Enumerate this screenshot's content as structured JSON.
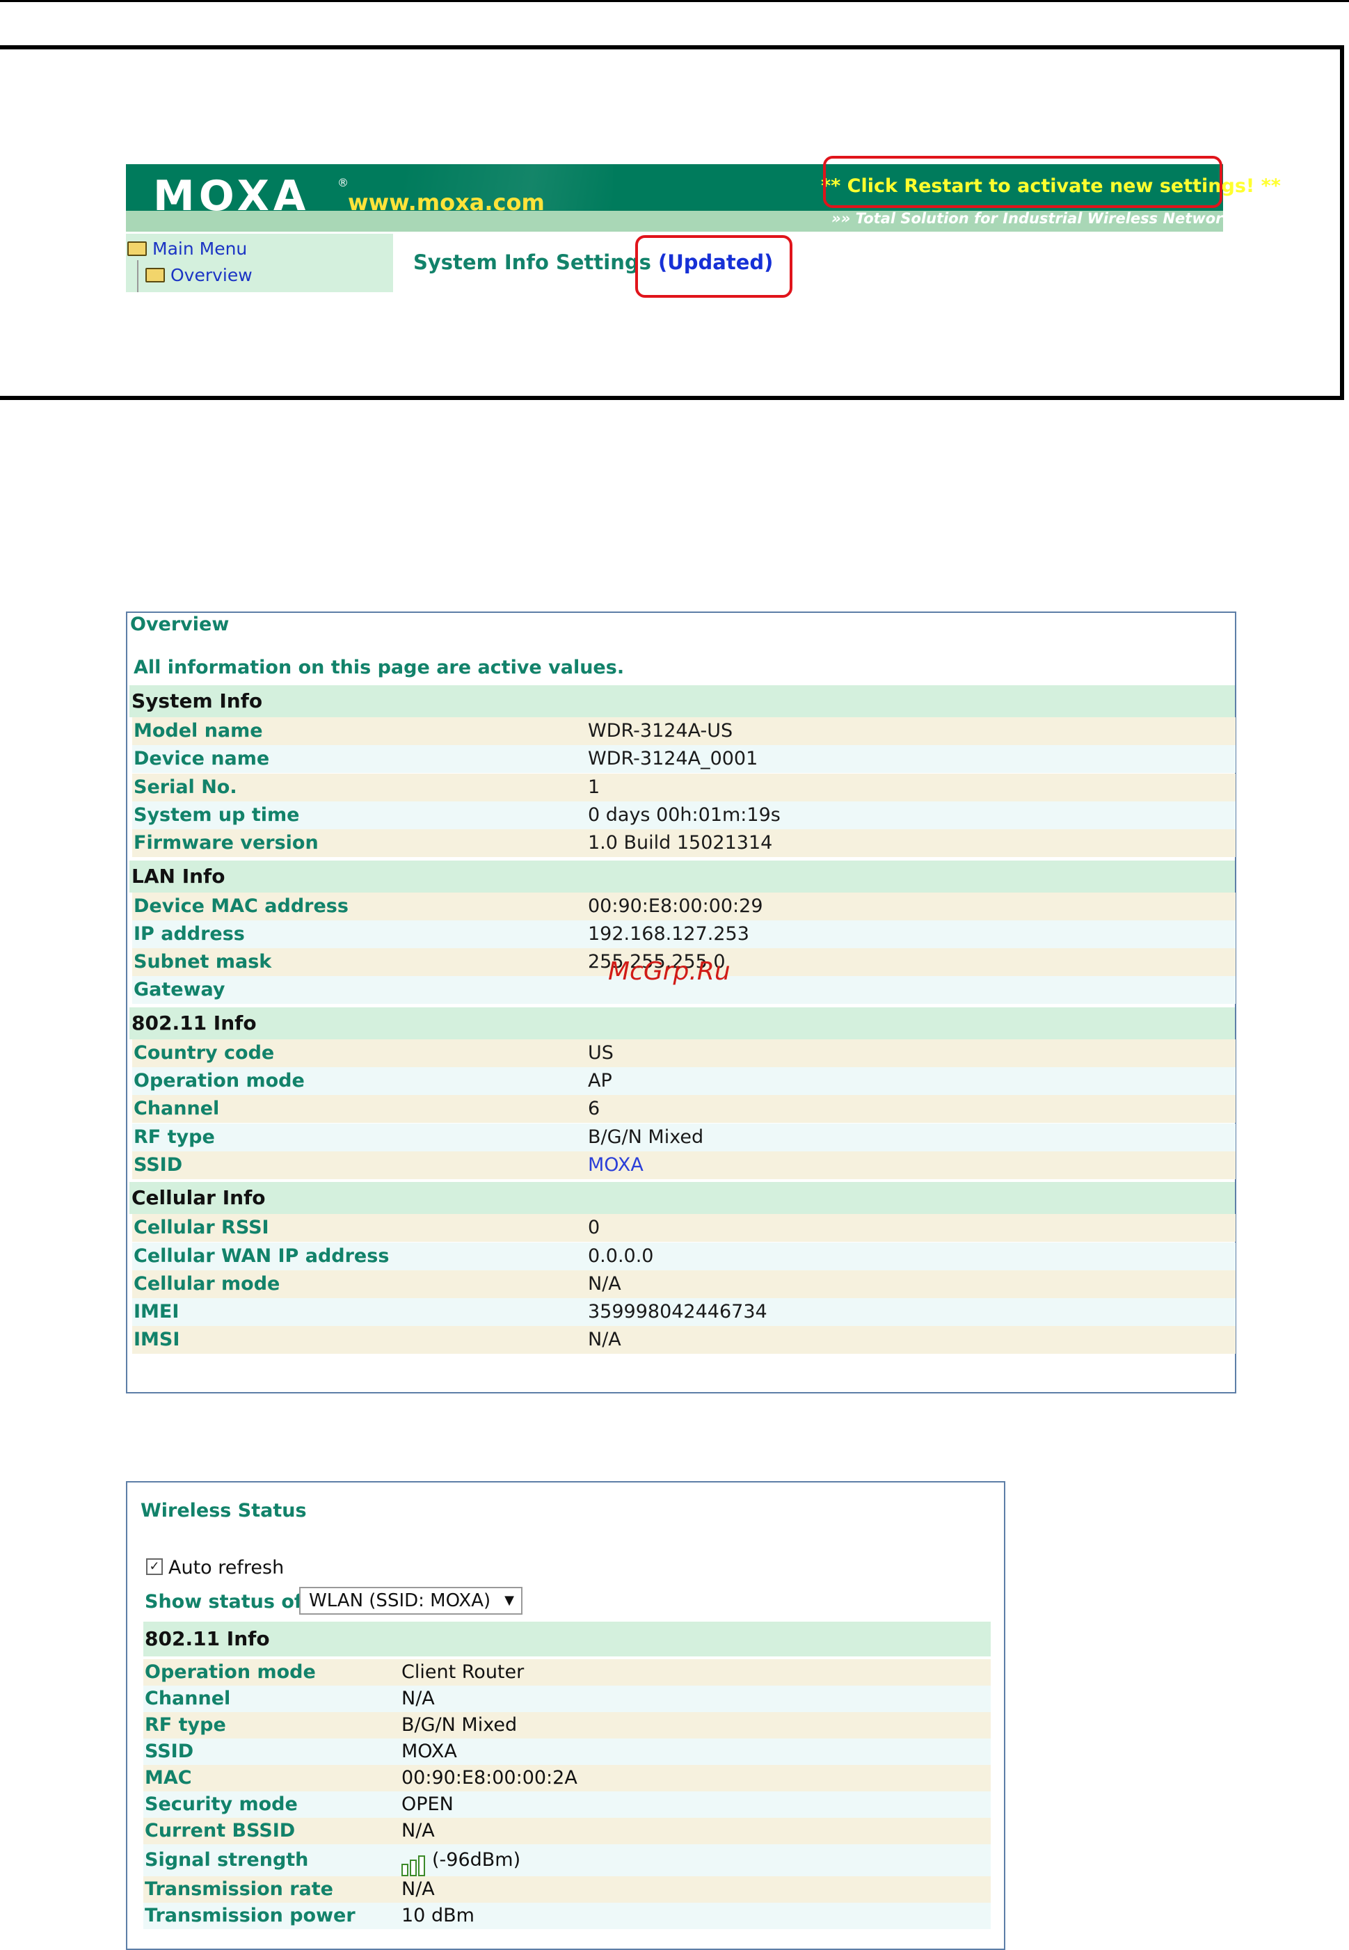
{
  "header": {
    "logo_text": "MOXA",
    "logo_reg": "®",
    "url": "www.moxa.com",
    "restart_prefix": "** Click ",
    "restart_word": "Restart",
    "restart_suffix": " to activate new settings! **",
    "tagline": "»» Total Solution for Industrial Wireless Networking",
    "colors": {
      "banner": "#007b5c",
      "accent_yellow": "#ffff2e",
      "highlight_red": "#e0141b"
    }
  },
  "menu": {
    "main": "Main Menu",
    "overview": "Overview"
  },
  "sys_title": {
    "text": "System Info Settings",
    "updated": "(Updated)"
  },
  "overview": {
    "title": "Overview",
    "note": "All information on this page are active values.",
    "sections": [
      {
        "title": "System Info",
        "rows": [
          {
            "k": "Model name",
            "v": "WDR-3124A-US"
          },
          {
            "k": "Device name",
            "v": "WDR-3124A_0001"
          },
          {
            "k": "Serial No.",
            "v": "1"
          },
          {
            "k": "System up time",
            "v": "0 days 00h:01m:19s"
          },
          {
            "k": "Firmware version",
            "v": "1.0 Build 15021314"
          }
        ]
      },
      {
        "title": "LAN Info",
        "rows": [
          {
            "k": "Device MAC address",
            "v": "00:90:E8:00:00:29"
          },
          {
            "k": "IP address",
            "v": "192.168.127.253"
          },
          {
            "k": "Subnet mask",
            "v": "255.255.255.0"
          },
          {
            "k": "Gateway",
            "v": ""
          }
        ]
      },
      {
        "title": "802.11 Info",
        "rows": [
          {
            "k": "Country code",
            "v": "US"
          },
          {
            "k": "Operation mode",
            "v": "AP"
          },
          {
            "k": "Channel",
            "v": "6"
          },
          {
            "k": "RF type",
            "v": "B/G/N Mixed"
          },
          {
            "k": "SSID",
            "v": "MOXA"
          }
        ]
      },
      {
        "title": "Cellular Info",
        "rows": [
          {
            "k": "Cellular RSSI",
            "v": "0"
          },
          {
            "k": "Cellular WAN IP address",
            "v": "0.0.0.0"
          },
          {
            "k": "Cellular mode",
            "v": "N/A"
          },
          {
            "k": "IMEI",
            "v": "359998042446734"
          },
          {
            "k": "IMSI",
            "v": "N/A"
          }
        ]
      }
    ]
  },
  "watermark": "McGrp.Ru",
  "wireless": {
    "title": "Wireless Status",
    "auto_refresh": "Auto refresh",
    "auto_refresh_checked": true,
    "show_status_label": "Show status of",
    "show_status_value": "WLAN (SSID: MOXA)",
    "section": "802.11 Info",
    "rows": [
      {
        "k": "Operation mode",
        "v": "Client Router"
      },
      {
        "k": "Channel",
        "v": "N/A"
      },
      {
        "k": "RF type",
        "v": "B/G/N Mixed"
      },
      {
        "k": "SSID",
        "v": "MOXA"
      },
      {
        "k": "MAC",
        "v": "00:90:E8:00:00:2A"
      },
      {
        "k": "Security mode",
        "v": "OPEN"
      },
      {
        "k": "Current BSSID",
        "v": "N/A"
      },
      {
        "k": "Signal strength",
        "v": "(-96dBm)"
      },
      {
        "k": "Transmission rate",
        "v": "N/A"
      },
      {
        "k": "Transmission power",
        "v": "10 dBm"
      }
    ]
  }
}
